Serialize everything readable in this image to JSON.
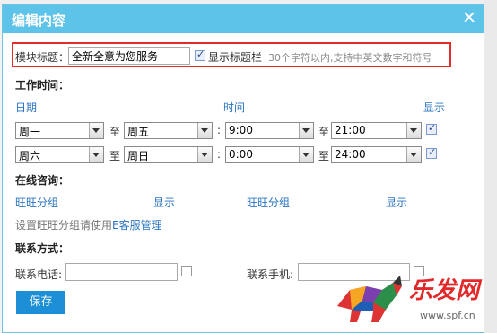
{
  "dialog": {
    "title": "编辑内容",
    "close_glyph": "✕"
  },
  "module_title": {
    "label": "模块标题：",
    "value": "全新全意为您服务",
    "show_title_bar_label": "显示标题栏",
    "show_title_bar_checked": true,
    "hint": "30个字符以内,支持中英文数字和符号"
  },
  "work_time": {
    "section_label": "工作时间：",
    "col_date": "日期",
    "col_time": "时间",
    "col_show": "显示",
    "to_label": "至",
    "colon": ":",
    "rows": [
      {
        "day_from": "周一",
        "day_to": "周五",
        "time_from": "9:00",
        "time_to": "21:00",
        "show": true
      },
      {
        "day_from": "周六",
        "day_to": "周日",
        "time_from": "0:00",
        "time_to": "24:00",
        "show": true
      }
    ]
  },
  "online": {
    "section_label": "在线咨询：",
    "col_group_1": "旺旺分组",
    "col_show_1": "显示",
    "col_group_2": "旺旺分组",
    "col_show_2": "显示",
    "note_prefix": "设置旺旺分组请使用",
    "note_link": "E客服管理"
  },
  "contact": {
    "section_label": "联系方式：",
    "phone_label": "联系电话:",
    "phone_value": "",
    "mobile_label": "联系手机:",
    "mobile_value": ""
  },
  "save_label": "保存",
  "watermark": {
    "brand": "乐发网",
    "url": "www.spf.cn"
  },
  "colors": {
    "titlebar": "#5ec3e8",
    "highlight_border": "#e52a2a",
    "link": "#2a73c2",
    "save_button": "#1d8fd6"
  }
}
